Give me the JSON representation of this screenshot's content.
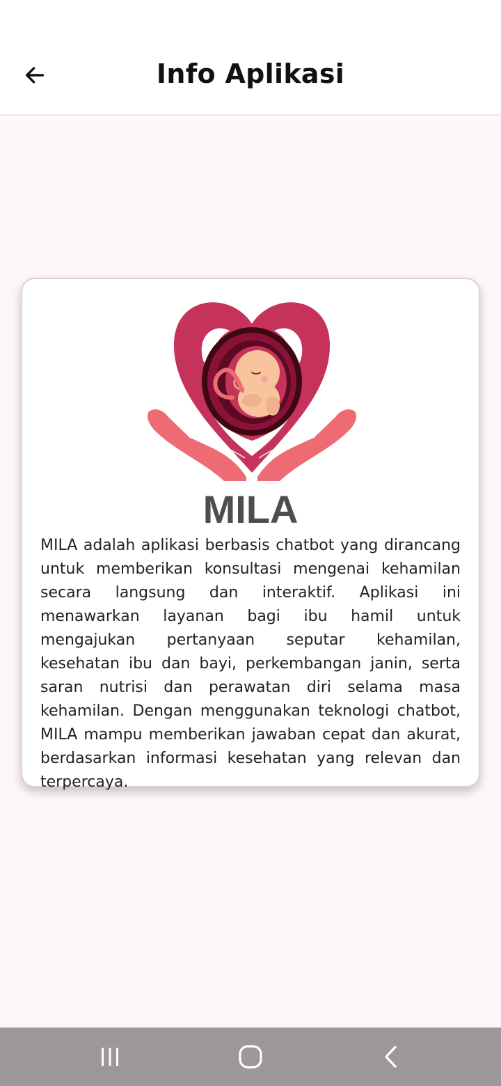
{
  "app_bar": {
    "title": "Info Aplikasi",
    "back_icon": "arrow-left-icon"
  },
  "card": {
    "logo_icon": "mother-hands-fetus-heart-logo",
    "app_name": "MILA",
    "description": "MILA adalah aplikasi berbasis chatbot yang dirancang untuk memberikan konsultasi mengenai kehamilan secara langsung dan interaktif. Aplikasi ini menawarkan layanan bagi ibu hamil untuk mengajukan pertanyaan seputar kehamilan, kesehatan ibu dan bayi, perkembangan janin, serta saran nutrisi dan perawatan diri selama masa kehamilan. Dengan menggunakan teknologi chatbot, MILA mampu memberikan jawaban cepat dan akurat, berdasarkan informasi kesehatan yang relevan dan terpercaya."
  },
  "nav_bar": {
    "recents_icon": "recents-icon",
    "home_icon": "home-icon",
    "back_icon": "nav-back-icon"
  },
  "colors": {
    "background": "#fdf6fb",
    "heart": "#c5325a",
    "hands": "#ee6b73",
    "womb_dark": "#5a0a22",
    "baby_skin": "#f7c49d",
    "nav_bar": "#9b979b"
  }
}
